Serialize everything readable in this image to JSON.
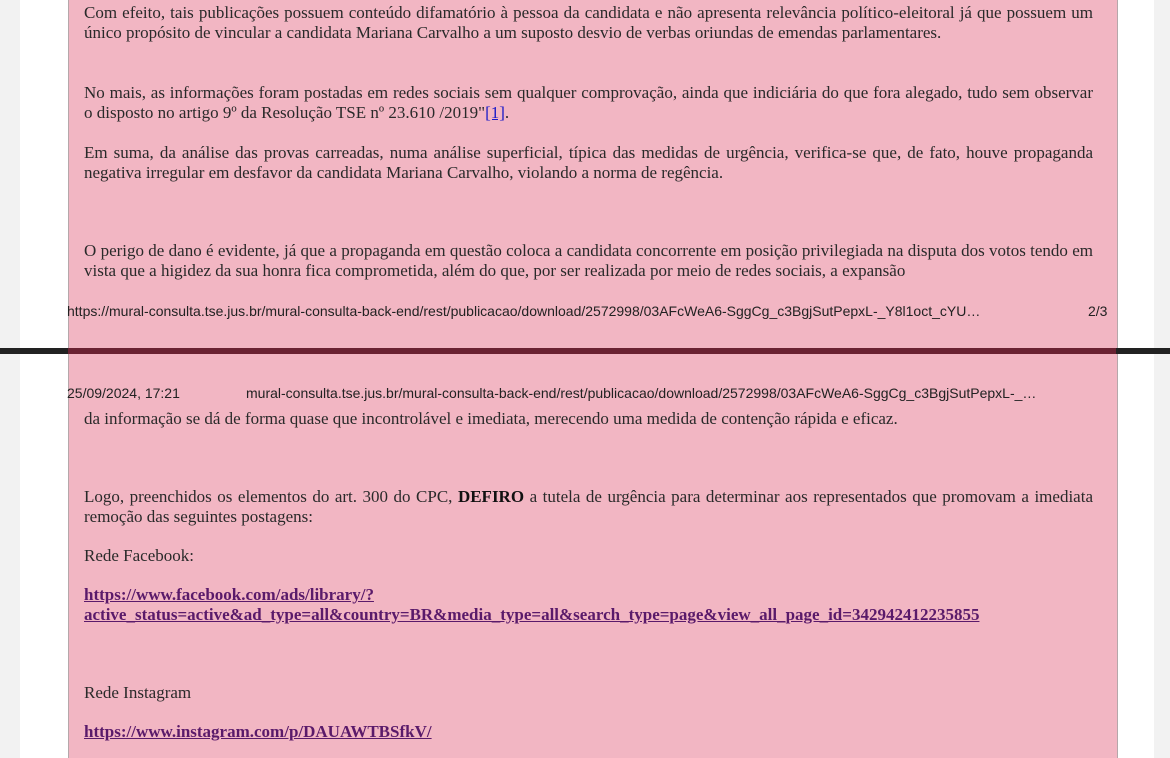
{
  "page1": {
    "paragraphs": [
      "Com efeito, tais publicações possuem conteúdo difamatório à pessoa da candidata e não apresenta relevância político-eleitoral já que possuem um único propósito de vincular a candidata Mariana Carvalho a um suposto desvio de verbas oriundas de emendas parlamentares.",
      "Em suma, da análise das provas carreadas, numa análise superficial, típica das medidas de urgência, verifica-se que, de fato, houve propaganda negativa irregular em desfavor da candidata Mariana Carvalho, violando a norma de regência.",
      "O perigo de dano é evidente, já que a propaganda em questão coloca a candidata concorrente em posição privilegiada na disputa dos votos tendo em vista que a higidez da sua honra fica comprometida, além do que, por ser realizada por meio de redes sociais, a expansão"
    ],
    "para2_text": "No mais, as informações foram postadas em redes sociais sem qualquer comprovação, ainda que indiciária do que fora alegado, tudo sem observar o disposto no artigo 9º da Resolução TSE nº 23.610 /2019\"",
    "para2_ref": "[1]",
    "para2_end": ".",
    "footer_url": "https://mural-consulta.tse.jus.br/mural-consulta-back-end/rest/publicacao/download/2572998/03AFcWeA6-SggCg_c3BgjSutPepxL-_Y8l1oct_cYU…",
    "footer_page": "2/3"
  },
  "page2": {
    "header_date": "25/09/2024, 17:21",
    "header_url": "mural-consulta.tse.jus.br/mural-consulta-back-end/rest/publicacao/download/2572998/03AFcWeA6-SggCg_c3BgjSutPepxL-_…",
    "continuation": "da informação se dá de forma quase que incontrolável e imediata, merecendo uma medida de contenção rápida e eficaz.",
    "logo_pre": "Logo, preenchidos os elementos do art.  300 do CPC, ",
    "logo_bold": "DEFIRO",
    "logo_post": " a tutela de urgência para determinar aos representados que promovam a imediata remoção das seguintes postagens:",
    "facebook_label": "Rede Facebook:",
    "facebook_link_line1": "https://www.facebook.com/ads/library/?",
    "facebook_link_line2": "active_status=active&ad_type=all&country=BR&media_type=all&search_type=page&view_all_page_id=342942412235855",
    "instagram_label": "Rede Instagram",
    "instagram_link": "https://www.instagram.com/p/DAUAWTBSfkV/"
  },
  "colors": {
    "highlight": "#f2b6c3",
    "link": "#5a1a6a",
    "ref_link": "#1a1ac8"
  }
}
